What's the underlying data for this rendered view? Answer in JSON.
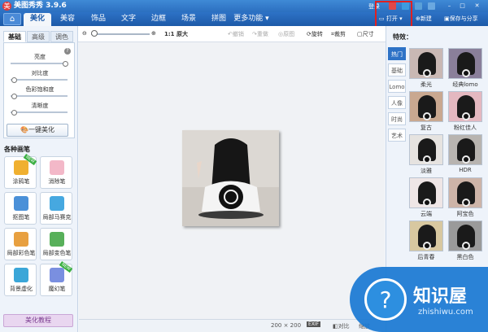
{
  "app": {
    "title": "美图秀秀  3.9.6",
    "login": "登录"
  },
  "menubar": {
    "tabs": [
      "美化",
      "美容",
      "饰品",
      "文字",
      "边框",
      "场景",
      "拼图",
      "更多功能 ▾"
    ],
    "active_tab": "美化",
    "open": "打开",
    "new": "新建",
    "save_share": "保存与分享"
  },
  "left_panel": {
    "subtabs": [
      "基础",
      "高级",
      "调色"
    ],
    "sliders": [
      {
        "label": "亮度",
        "value": 0.95
      },
      {
        "label": "对比度",
        "value": 0.05
      },
      {
        "label": "色彩饱和度",
        "value": 0.05
      },
      {
        "label": "清晰度",
        "value": 0.05
      }
    ],
    "one_click": "一键美化",
    "brush_header": "各种画笔",
    "tools": [
      {
        "label": "涂鸦笔",
        "icon": "doodle-pen-icon",
        "color": "#f0b030",
        "tag": "NEW"
      },
      {
        "label": "消除笔",
        "icon": "eraser-pen-icon",
        "color": "#f3b8c8"
      },
      {
        "label": "抠图笔",
        "icon": "cutout-pen-icon",
        "color": "#4a90d8"
      },
      {
        "label": "局部马赛克",
        "icon": "mosaic-icon",
        "color": "#46a8e0"
      },
      {
        "label": "局部彩色笔",
        "icon": "color-brush-icon",
        "color": "#e8a040"
      },
      {
        "label": "局部变色笔",
        "icon": "recolor-bucket-icon",
        "color": "#58b05a"
      },
      {
        "label": "背景虚化",
        "icon": "blur-background-icon",
        "color": "#3aa6d8"
      },
      {
        "label": "魔幻笔",
        "icon": "magic-pen-icon",
        "color": "#7a8fe0",
        "tag": "NEW"
      }
    ],
    "tutorial": "美化教程"
  },
  "toolbar": {
    "zoom_value": 0.05,
    "original_size": "1:1 原大",
    "undo": "撤销",
    "redo": "重做",
    "original": "原图",
    "rotate": "旋转",
    "crop": "裁剪",
    "resize": "尺寸"
  },
  "status": {
    "size": "200 × 200",
    "exif": "EXIF",
    "compare": "对比",
    "zoom_label": "缩放"
  },
  "right_panel": {
    "header": "特效：",
    "categories": [
      "热门",
      "基础",
      "Lomo",
      "人像",
      "时尚",
      "艺术"
    ],
    "active_category": "热门",
    "effects": [
      {
        "name": "柔光",
        "tint": "#c9b8b4"
      },
      {
        "name": "经典lomo",
        "tint": "#8a7f9a"
      },
      {
        "name": "复古",
        "tint": "#c9a890"
      },
      {
        "name": "粉红佳人",
        "tint": "#e4b8c0"
      },
      {
        "name": "淡雅",
        "tint": "#e6e3e0"
      },
      {
        "name": "HDR",
        "tint": "#b8b4b0"
      },
      {
        "name": "云端",
        "tint": "#efe6e6"
      },
      {
        "name": "阿宝色",
        "tint": "#cdb4a8"
      },
      {
        "name": "后青春",
        "tint": "#d8c8a0"
      },
      {
        "name": "黑白色",
        "tint": "#9a9a9a"
      }
    ]
  },
  "watermark": {
    "title": "知识屋",
    "url": "zhishiwu.com"
  }
}
